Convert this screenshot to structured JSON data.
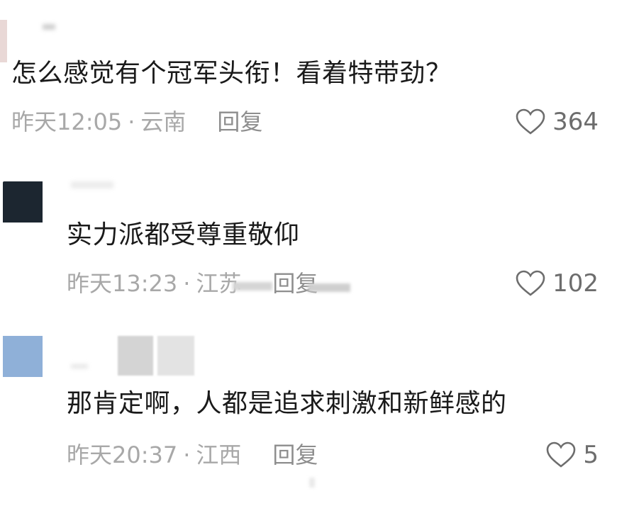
{
  "comments": [
    {
      "text": "怎么感觉有个冠军头衔！看着特带劲？",
      "time": "昨天12:05",
      "location": "云南",
      "reply_label": "回复",
      "likes": "364"
    },
    {
      "text": "实力派都受尊重敬仰",
      "time": "昨天13:23",
      "location": "江苏",
      "reply_label": "回复",
      "likes": "102"
    },
    {
      "text": "那肯定啊，人都是追求刺激和新鲜感的",
      "time": "昨天20:37",
      "location": "江西",
      "reply_label": "回复",
      "likes": "5"
    }
  ],
  "separator": "·",
  "icons": {
    "like": "heart-outline-icon"
  }
}
